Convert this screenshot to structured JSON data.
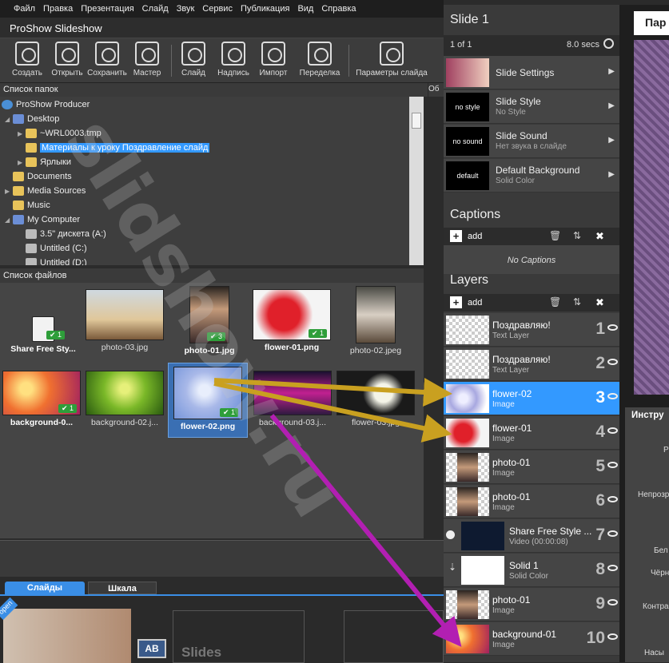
{
  "menu": [
    "Файл",
    "Правка",
    "Презентация",
    "Слайд",
    "Звук",
    "Сервис",
    "Публикация",
    "Вид",
    "Справка"
  ],
  "app_title": "ProShow Slideshow",
  "toolbar": [
    "Создать",
    "Открыть",
    "Сохранить",
    "Мастер",
    "Слайд",
    "Надпись",
    "Импорт",
    "Переделка",
    "Параметры слайда"
  ],
  "folders_header": "Список папок",
  "obj_tab": "Об",
  "tree": [
    {
      "label": "ProShow Producer"
    },
    {
      "label": "Desktop"
    },
    {
      "label": "~WRL0003.tmp"
    },
    {
      "label": "Материалы к уроку Поздравление слайд"
    },
    {
      "label": "Ярлыки"
    },
    {
      "label": "Documents"
    },
    {
      "label": "Media Sources"
    },
    {
      "label": "Music"
    },
    {
      "label": "My Computer"
    },
    {
      "label": "3.5\" дискета (A:)"
    },
    {
      "label": "Untitled (C:)"
    },
    {
      "label": "Untitled (D:)"
    }
  ],
  "files_header": "Список файлов",
  "files": [
    {
      "name": "Share Free Sty...",
      "badge": "1"
    },
    {
      "name": "photo-03.jpg",
      "badge": ""
    },
    {
      "name": "photo-01.jpg",
      "badge": "3"
    },
    {
      "name": "flower-01.png",
      "badge": "1"
    },
    {
      "name": "photo-02.jpeg",
      "badge": ""
    },
    {
      "name": "background-0...",
      "badge": "1"
    },
    {
      "name": "background-02.j...",
      "badge": ""
    },
    {
      "name": "flower-02.png",
      "badge": "1"
    },
    {
      "name": "background-03.j...",
      "badge": ""
    },
    {
      "name": "flower-03.jpg",
      "badge": ""
    }
  ],
  "bottom_tabs": {
    "slides": "Слайды",
    "timeline": "Шкала"
  },
  "slides_placeholder": "Slides",
  "open_ribbon": "open",
  "ab_label": "AB",
  "slide_panel": {
    "title": "Slide 1",
    "counter": "1 of 1",
    "duration": "8.0 secs",
    "settings": [
      {
        "thumb": "",
        "title": "Slide Settings",
        "sub": ""
      },
      {
        "thumb": "no style",
        "title": "Slide Style",
        "sub": "No Style"
      },
      {
        "thumb": "no sound",
        "title": "Slide Sound",
        "sub": "Нет звука в слайде"
      },
      {
        "thumb": "default",
        "title": "Default Background",
        "sub": "Solid Color"
      }
    ],
    "captions_title": "Captions",
    "add_label": "add",
    "no_captions": "No Captions",
    "layers_title": "Layers",
    "layers": [
      {
        "name": "Поздравляю!",
        "type": "Text Layer",
        "num": "1"
      },
      {
        "name": "Поздравляю!",
        "type": "Text Layer",
        "num": "2"
      },
      {
        "name": "flower-02",
        "type": "Image",
        "num": "3"
      },
      {
        "name": "flower-01",
        "type": "Image",
        "num": "4"
      },
      {
        "name": "photo-01",
        "type": "Image",
        "num": "5"
      },
      {
        "name": "photo-01",
        "type": "Image",
        "num": "6"
      },
      {
        "name": "Share Free Style ...",
        "type": "Video (00:00:08)",
        "num": "7"
      },
      {
        "name": "Solid 1",
        "type": "Solid Color",
        "num": "8"
      },
      {
        "name": "photo-01",
        "type": "Image",
        "num": "9"
      },
      {
        "name": "background-01",
        "type": "Image",
        "num": "10"
      }
    ]
  },
  "right": {
    "param_tab": "Пар",
    "tools_head": "Инстру",
    "labels": [
      "Р",
      "Непрозр",
      "Бел",
      "Чёрн",
      "Контра",
      "Насы"
    ]
  },
  "watermark": "slidshow.ru",
  "colors": {
    "accent": "#3399ff",
    "arrow_gold": "#c9a020",
    "arrow_magenta": "#b21fb2"
  }
}
